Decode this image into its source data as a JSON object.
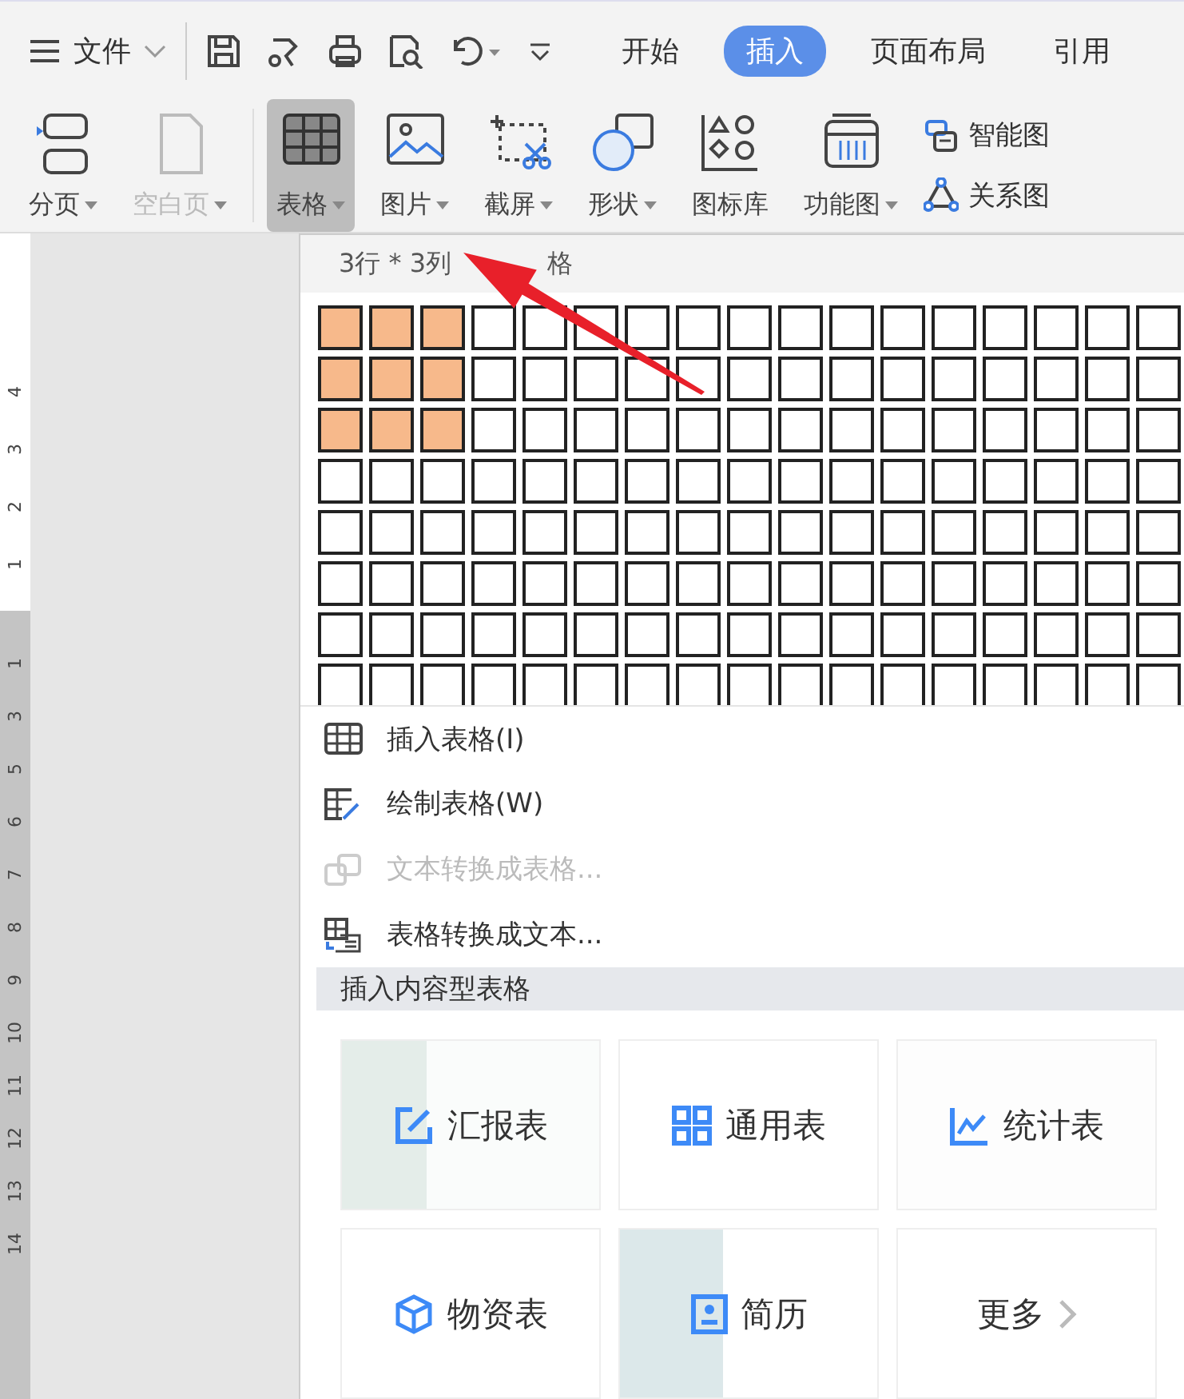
{
  "toolbar": {
    "menu_label": "文件",
    "tabs": [
      {
        "label": "开始",
        "selected": false
      },
      {
        "label": "插入",
        "selected": true
      },
      {
        "label": "页面布局",
        "selected": false
      },
      {
        "label": "引用",
        "selected": false
      }
    ]
  },
  "ribbon": {
    "items": [
      {
        "label": "分页",
        "kind": "page-break",
        "dropdown": true,
        "disabled": false,
        "pressed": false
      },
      {
        "label": "空白页",
        "kind": "blank-page",
        "dropdown": true,
        "disabled": true,
        "pressed": false
      },
      {
        "label": "表格",
        "kind": "table",
        "dropdown": true,
        "disabled": false,
        "pressed": true
      },
      {
        "label": "图片",
        "kind": "picture",
        "dropdown": true,
        "disabled": false,
        "pressed": false
      },
      {
        "label": "截屏",
        "kind": "screenshot",
        "dropdown": true,
        "disabled": false,
        "pressed": false
      },
      {
        "label": "形状",
        "kind": "shapes",
        "dropdown": true,
        "disabled": false,
        "pressed": false
      },
      {
        "label": "图标库",
        "kind": "icons",
        "dropdown": false,
        "disabled": false,
        "pressed": false
      },
      {
        "label": "功能图",
        "kind": "function",
        "dropdown": true,
        "disabled": false,
        "pressed": false
      }
    ],
    "side": [
      {
        "label": "智能图",
        "kind": "smart"
      },
      {
        "label": "关系图",
        "kind": "relation"
      }
    ]
  },
  "ruler": {
    "labels": [
      {
        "text": "4",
        "shaded": false
      },
      {
        "text": "3",
        "shaded": false
      },
      {
        "text": "2",
        "shaded": false
      },
      {
        "text": "1",
        "shaded": false
      },
      {
        "text": "1",
        "shaded": true
      },
      {
        "text": "3",
        "shaded": true
      },
      {
        "text": "5",
        "shaded": true
      },
      {
        "text": "6",
        "shaded": true
      },
      {
        "text": "7",
        "shaded": true
      },
      {
        "text": "8",
        "shaded": true
      },
      {
        "text": "9",
        "shaded": true
      },
      {
        "text": "10",
        "shaded": true
      },
      {
        "text": "11",
        "shaded": true
      },
      {
        "text": "12",
        "shaded": true
      },
      {
        "text": "13",
        "shaded": true
      },
      {
        "text": "14",
        "shaded": true
      }
    ]
  },
  "table_menu": {
    "header": {
      "size": "3行 * 3列",
      "tail": "格"
    },
    "grid": [
      [
        true,
        true,
        true,
        false,
        false,
        false,
        false,
        false,
        false,
        false,
        false,
        false,
        false,
        false,
        false,
        false,
        false
      ],
      [
        true,
        true,
        true,
        false,
        false,
        false,
        false,
        false,
        false,
        false,
        false,
        false,
        false,
        false,
        false,
        false,
        false
      ],
      [
        true,
        true,
        true,
        false,
        false,
        false,
        false,
        false,
        false,
        false,
        false,
        false,
        false,
        false,
        false,
        false,
        false
      ],
      [
        false,
        false,
        false,
        false,
        false,
        false,
        false,
        false,
        false,
        false,
        false,
        false,
        false,
        false,
        false,
        false,
        false
      ],
      [
        false,
        false,
        false,
        false,
        false,
        false,
        false,
        false,
        false,
        false,
        false,
        false,
        false,
        false,
        false,
        false,
        false
      ],
      [
        false,
        false,
        false,
        false,
        false,
        false,
        false,
        false,
        false,
        false,
        false,
        false,
        false,
        false,
        false,
        false,
        false
      ],
      [
        false,
        false,
        false,
        false,
        false,
        false,
        false,
        false,
        false,
        false,
        false,
        false,
        false,
        false,
        false,
        false,
        false
      ],
      [
        false,
        false,
        false,
        false,
        false,
        false,
        false,
        false,
        false,
        false,
        false,
        false,
        false,
        false,
        false,
        false,
        false
      ]
    ],
    "items": [
      {
        "label": "插入表格(I)",
        "kind": "insert",
        "disabled": false
      },
      {
        "label": "绘制表格(W)",
        "kind": "draw",
        "disabled": false
      },
      {
        "label": "文本转换成表格...",
        "kind": "text-to-table",
        "disabled": true
      },
      {
        "label": "表格转换成文本...",
        "kind": "table-to-text",
        "disabled": false
      }
    ],
    "section_title": "插入内容型表格",
    "templates": [
      {
        "label": "汇报表",
        "kind": "report"
      },
      {
        "label": "通用表",
        "kind": "general"
      },
      {
        "label": "统计表",
        "kind": "stats"
      },
      {
        "label": "物资表",
        "kind": "supplies"
      },
      {
        "label": "简历",
        "kind": "resume"
      },
      {
        "label": "更多",
        "kind": "more"
      }
    ]
  }
}
